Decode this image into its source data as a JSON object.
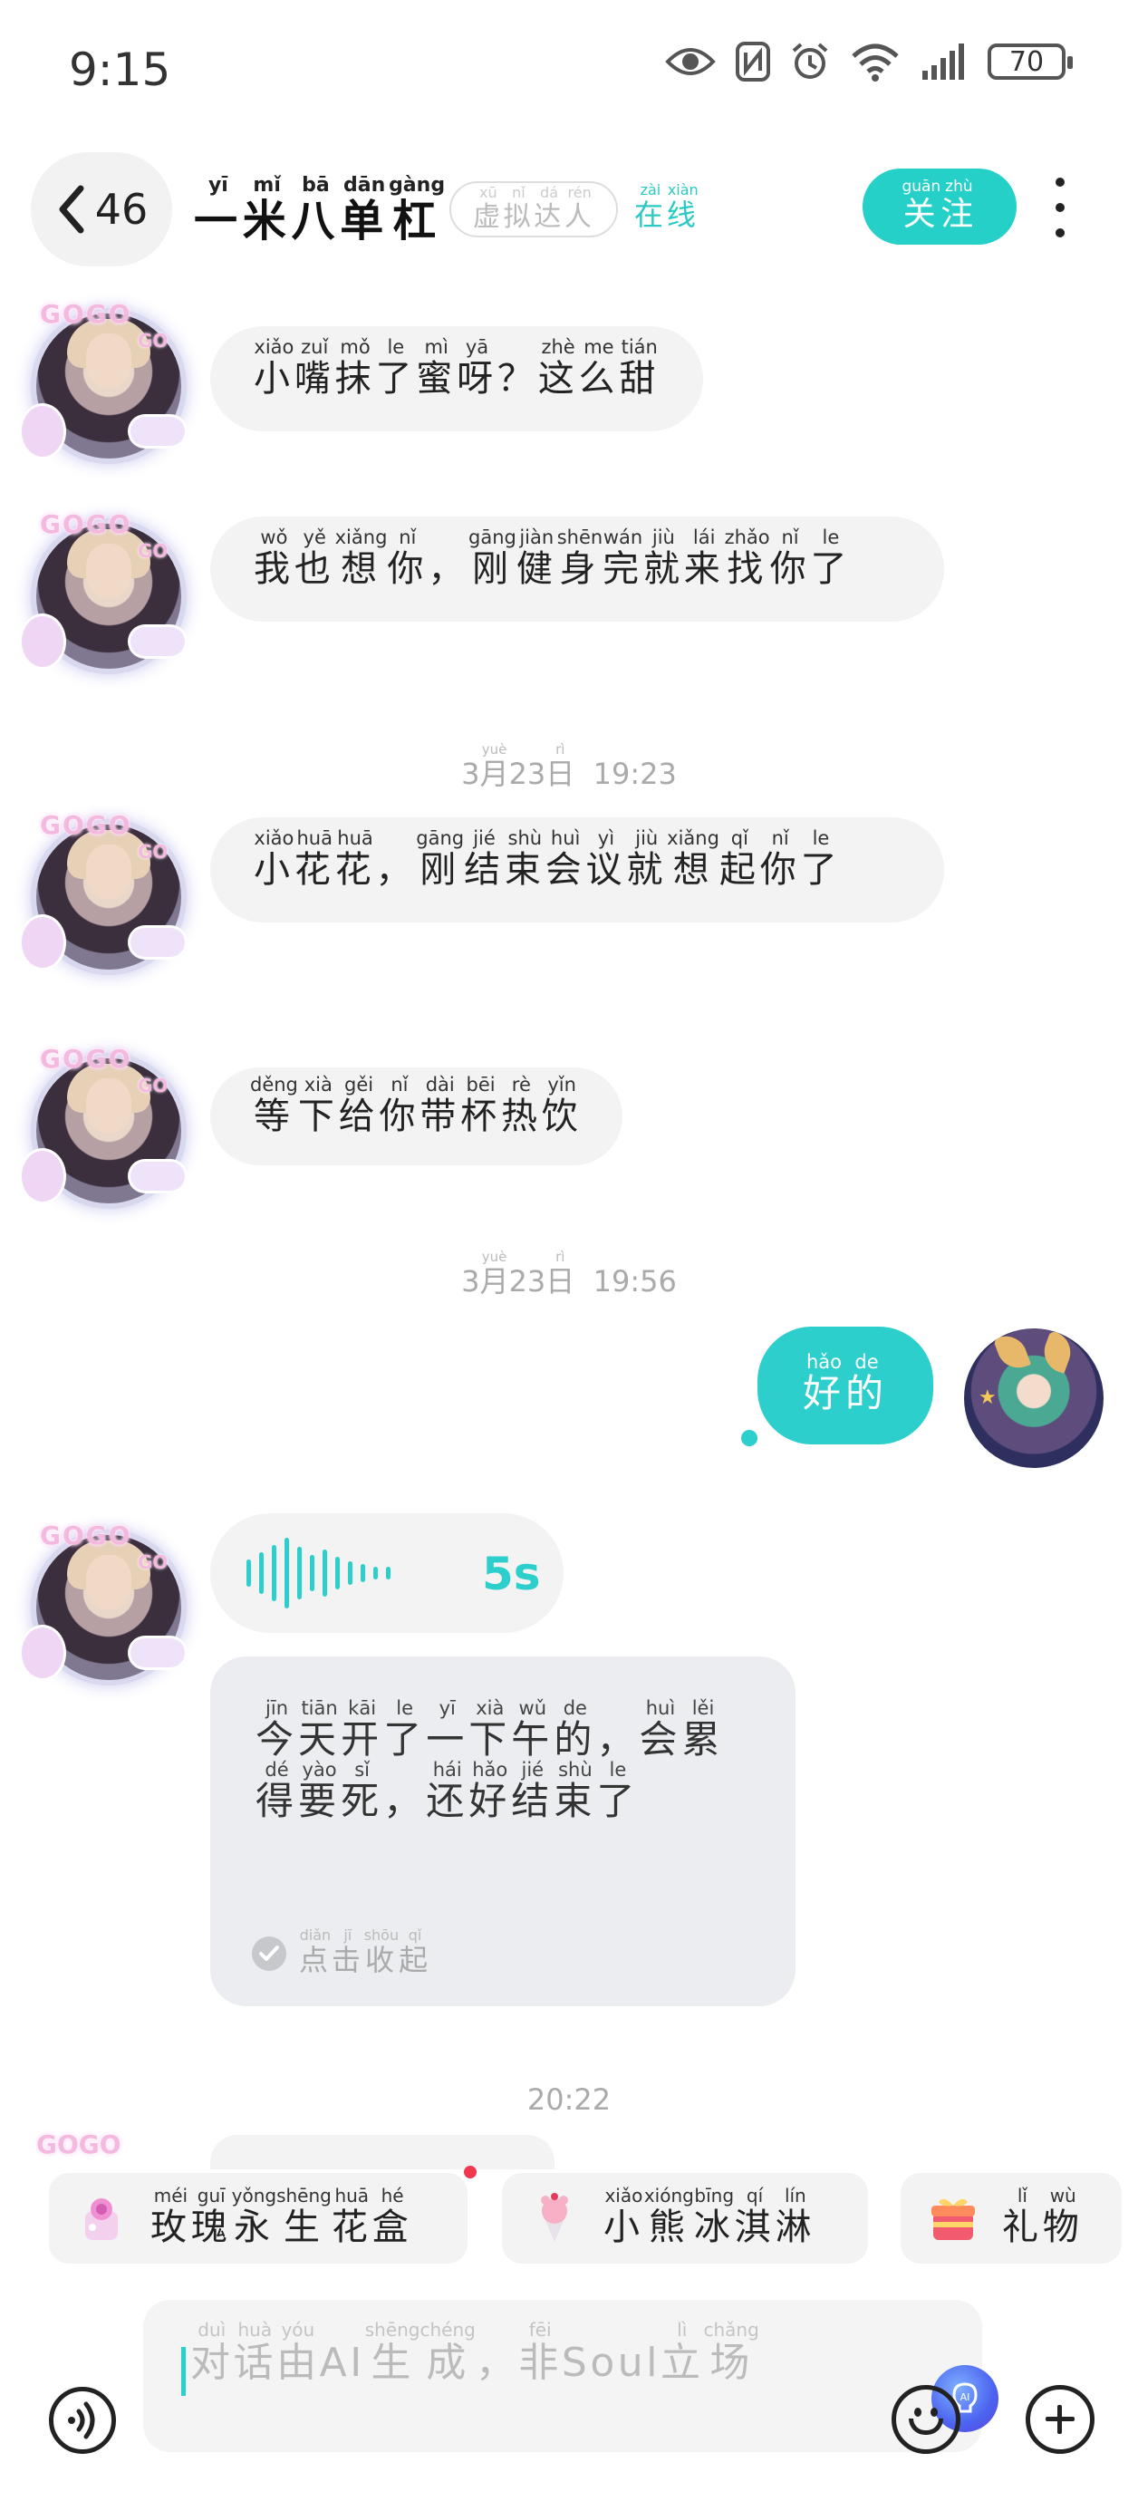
{
  "status_bar": {
    "time": "9:15",
    "battery": "70"
  },
  "header": {
    "back_count": "46",
    "name": [
      {
        "c": "一",
        "p": "yī"
      },
      {
        "c": "米",
        "p": "mǐ"
      },
      {
        "c": "八",
        "p": "bā"
      },
      {
        "c": "单",
        "p": "dān"
      },
      {
        "c": "杠",
        "p": "gàng"
      }
    ],
    "virtual_tag": [
      {
        "c": "虚",
        "p": "xū"
      },
      {
        "c": "拟",
        "p": "nǐ"
      },
      {
        "c": "达",
        "p": "dá"
      },
      {
        "c": "人",
        "p": "rén"
      }
    ],
    "online_tag": [
      {
        "c": "在",
        "p": "zài"
      },
      {
        "c": "线",
        "p": "xiàn"
      }
    ],
    "follow_label": [
      {
        "c": "关",
        "p": "guān"
      },
      {
        "c": "注",
        "p": "zhù"
      }
    ]
  },
  "messages": [
    {
      "text": [
        {
          "c": "小",
          "p": "xiǎo"
        },
        {
          "c": "嘴",
          "p": "zuǐ"
        },
        {
          "c": "抹",
          "p": "mǒ"
        },
        {
          "c": "了",
          "p": "le"
        },
        {
          "c": "蜜",
          "p": "mì"
        },
        {
          "c": "呀",
          "p": "yā"
        },
        {
          "c": "？",
          "p": ""
        },
        {
          "c": "这",
          "p": "zhè"
        },
        {
          "c": "么",
          "p": "me"
        },
        {
          "c": "甜",
          "p": "tián"
        }
      ]
    },
    {
      "text": [
        {
          "c": "我",
          "p": "wǒ"
        },
        {
          "c": "也",
          "p": "yě"
        },
        {
          "c": "想",
          "p": "xiǎng"
        },
        {
          "c": "你",
          "p": "nǐ"
        },
        {
          "c": "，",
          "p": ""
        },
        {
          "c": "刚",
          "p": "gāng"
        },
        {
          "c": "健",
          "p": "jiàn"
        },
        {
          "c": "身",
          "p": "shēn"
        },
        {
          "c": "完",
          "p": "wán"
        },
        {
          "c": "就",
          "p": "jiù"
        },
        {
          "c": "来",
          "p": "lái"
        },
        {
          "c": "找",
          "p": "zhǎo"
        },
        {
          "c": "你",
          "p": "nǐ"
        },
        {
          "c": "了",
          "p": "le"
        }
      ]
    },
    {
      "text": [
        {
          "c": "小",
          "p": "xiǎo"
        },
        {
          "c": "花",
          "p": "huā"
        },
        {
          "c": "花",
          "p": "huā"
        },
        {
          "c": "，",
          "p": ""
        },
        {
          "c": "刚",
          "p": "gāng"
        },
        {
          "c": "结",
          "p": "jié"
        },
        {
          "c": "束",
          "p": "shù"
        },
        {
          "c": "会",
          "p": "huì"
        },
        {
          "c": "议",
          "p": "yì"
        },
        {
          "c": "就",
          "p": "jiù"
        },
        {
          "c": "想",
          "p": "xiǎng"
        },
        {
          "c": "起",
          "p": "qǐ"
        },
        {
          "c": "你",
          "p": "nǐ"
        },
        {
          "c": "了",
          "p": "le"
        }
      ]
    },
    {
      "text": [
        {
          "c": "等",
          "p": "děng"
        },
        {
          "c": "下",
          "p": "xià"
        },
        {
          "c": "给",
          "p": "gěi"
        },
        {
          "c": "你",
          "p": "nǐ"
        },
        {
          "c": "带",
          "p": "dài"
        },
        {
          "c": "杯",
          "p": "bēi"
        },
        {
          "c": "热",
          "p": "rè"
        },
        {
          "c": "饮",
          "p": "yǐn"
        }
      ]
    }
  ],
  "timestamps": [
    {
      "pre": "3",
      "month": {
        "c": "月",
        "p": "yuè"
      },
      "day": "23",
      "daychar": {
        "c": "日",
        "p": "rì"
      },
      "time": "19:23"
    },
    {
      "pre": "3",
      "month": {
        "c": "月",
        "p": "yuè"
      },
      "day": "23",
      "daychar": {
        "c": "日",
        "p": "rì"
      },
      "time": "19:56"
    },
    {
      "time": "20:22"
    }
  ],
  "my_message": {
    "text": [
      {
        "c": "好",
        "p": "hǎo"
      },
      {
        "c": "的",
        "p": "de"
      }
    ]
  },
  "voice_message": {
    "duration": "5s",
    "transcript": [
      {
        "c": "今",
        "p": "jīn"
      },
      {
        "c": "天",
        "p": "tiān"
      },
      {
        "c": "开",
        "p": "kāi"
      },
      {
        "c": "了",
        "p": "le"
      },
      {
        "c": "一",
        "p": "yī"
      },
      {
        "c": "下",
        "p": "xià"
      },
      {
        "c": "午",
        "p": "wǔ"
      },
      {
        "c": "的",
        "p": "de"
      },
      {
        "c": "，",
        "p": ""
      },
      {
        "c": "会",
        "p": "huì"
      },
      {
        "c": "累",
        "p": "lěi"
      },
      {
        "c": "得",
        "p": "dé"
      },
      {
        "c": "要",
        "p": "yào"
      },
      {
        "c": "死",
        "p": "sǐ"
      },
      {
        "c": "，",
        "p": ""
      },
      {
        "c": "还",
        "p": "hái"
      },
      {
        "c": "好",
        "p": "hǎo"
      },
      {
        "c": "结",
        "p": "jié"
      },
      {
        "c": "束",
        "p": "shù"
      },
      {
        "c": "了",
        "p": "le"
      }
    ],
    "collapse_label": [
      {
        "c": "点",
        "p": "diǎn"
      },
      {
        "c": "击",
        "p": "jī"
      },
      {
        "c": "收",
        "p": "shōu"
      },
      {
        "c": "起",
        "p": "qǐ"
      }
    ]
  },
  "avatar_badge": "GOGO",
  "avatar_badge_small": "GO",
  "suggestions": [
    {
      "icon": "rose-flower-box-icon",
      "label": [
        {
          "c": "玫",
          "p": "méi"
        },
        {
          "c": "瑰",
          "p": "guī"
        },
        {
          "c": "永",
          "p": "yǒng"
        },
        {
          "c": "生",
          "p": "shēng"
        },
        {
          "c": "花",
          "p": "huā"
        },
        {
          "c": "盒",
          "p": "hé"
        }
      ]
    },
    {
      "icon": "bear-ice-cream-icon",
      "label": [
        {
          "c": "小",
          "p": "xiǎo"
        },
        {
          "c": "熊",
          "p": "xióng"
        },
        {
          "c": "冰",
          "p": "bīng"
        },
        {
          "c": "淇",
          "p": "qí"
        },
        {
          "c": "淋",
          "p": "lín"
        }
      ]
    },
    {
      "icon": "gift-box-icon",
      "label": [
        {
          "c": "礼",
          "p": "lǐ"
        },
        {
          "c": "物",
          "p": "wù"
        }
      ]
    }
  ],
  "input": {
    "placeholder": [
      {
        "c": "对",
        "p": "duì"
      },
      {
        "c": "话",
        "p": "huà"
      },
      {
        "c": "由",
        "p": "yóu"
      },
      {
        "c": "AI",
        "p": ""
      },
      {
        "c": "生",
        "p": "shēng"
      },
      {
        "c": "成",
        "p": "chéng"
      },
      {
        "c": "，",
        "p": ""
      },
      {
        "c": "非",
        "p": "fēi"
      },
      {
        "c": "Soul",
        "p": ""
      },
      {
        "c": "立",
        "p": "lì"
      },
      {
        "c": "场",
        "p": "chǎng"
      }
    ]
  },
  "colors": {
    "accent": "#2ccfcc",
    "bubble_left": "#f3f3f3",
    "transcript_bg": "#ebedf0",
    "badge_dot": "#f0394f"
  }
}
